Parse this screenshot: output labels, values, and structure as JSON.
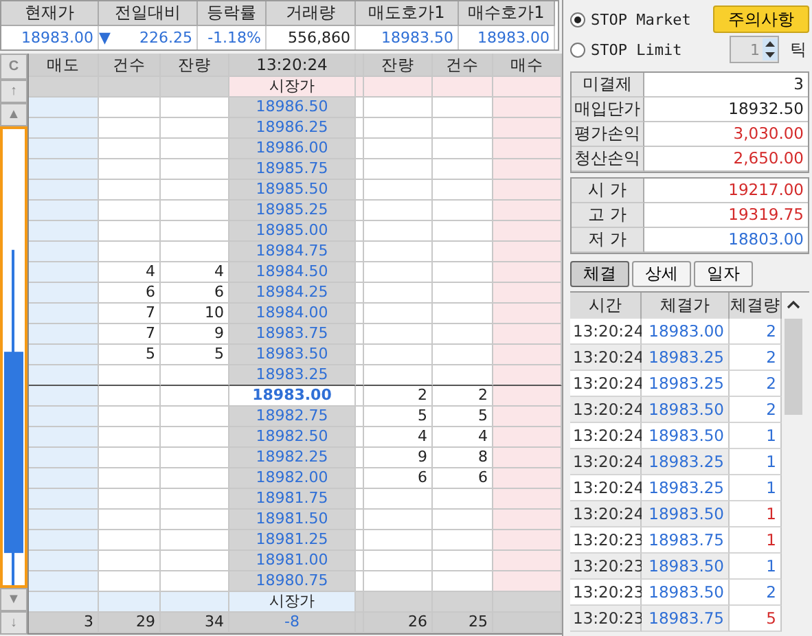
{
  "summary": {
    "columns": [
      "현재가",
      "전일대비",
      "등락률",
      "거래량",
      "매도호가1",
      "매수호가1"
    ],
    "values": [
      {
        "text": "18983.00",
        "color": "#2f6fd6"
      },
      {
        "arrow": "▼",
        "text": "226.25",
        "color": "#2f6fd6"
      },
      {
        "text": "-1.18%",
        "color": "#2f6fd6"
      },
      {
        "text": "556,860",
        "color": "#222222"
      },
      {
        "text": "18983.50",
        "color": "#2f6fd6"
      },
      {
        "text": "18983.00",
        "color": "#2f6fd6"
      }
    ]
  },
  "strip": {
    "top": [
      "C",
      "↑",
      "▲"
    ],
    "bottom": [
      "▼",
      "↓"
    ]
  },
  "orderbook": {
    "columns": [
      "매도",
      "건수",
      "잔량",
      "13:20:24",
      "잔량",
      "건수",
      "매수"
    ],
    "market_top": "시장가",
    "market_bottom": "시장가",
    "rows": [
      {
        "price": "18986.50",
        "current": false
      },
      {
        "price": "18986.25",
        "current": false
      },
      {
        "price": "18986.00",
        "current": false
      },
      {
        "price": "18985.75",
        "current": false
      },
      {
        "price": "18985.50",
        "current": false
      },
      {
        "price": "18985.25",
        "current": false
      },
      {
        "price": "18985.00",
        "current": false
      },
      {
        "price": "18984.75",
        "current": false
      },
      {
        "price": "18984.50",
        "sell_count": "4",
        "sell_qty": "4",
        "current": false
      },
      {
        "price": "18984.25",
        "sell_count": "6",
        "sell_qty": "6",
        "current": false
      },
      {
        "price": "18984.00",
        "sell_count": "7",
        "sell_qty": "10",
        "current": false
      },
      {
        "price": "18983.75",
        "sell_count": "7",
        "sell_qty": "9",
        "current": false
      },
      {
        "price": "18983.50",
        "sell_count": "5",
        "sell_qty": "5",
        "current": false
      },
      {
        "price": "18983.25",
        "current": false
      },
      {
        "price": "18983.00",
        "buy_qty": "2",
        "buy_count": "2",
        "current": true
      },
      {
        "price": "18982.75",
        "buy_qty": "5",
        "buy_count": "5",
        "current": false
      },
      {
        "price": "18982.50",
        "buy_qty": "4",
        "buy_count": "4",
        "current": false
      },
      {
        "price": "18982.25",
        "buy_qty": "9",
        "buy_count": "8",
        "current": false
      },
      {
        "price": "18982.00",
        "buy_qty": "6",
        "buy_count": "6",
        "current": false
      },
      {
        "price": "18981.75",
        "current": false
      },
      {
        "price": "18981.50",
        "current": false
      },
      {
        "price": "18981.25",
        "current": false
      },
      {
        "price": "18981.00",
        "current": false
      },
      {
        "price": "18980.75",
        "current": false
      }
    ],
    "totals": [
      "3",
      "29",
      "34",
      "-8",
      "26",
      "25"
    ]
  },
  "stop_orders": [
    {
      "label": "STOP Market",
      "selected": true
    },
    {
      "label": "STOP Limit",
      "selected": false
    }
  ],
  "notice_button": "주의사항",
  "tick_spinner": {
    "value": "1",
    "unit": "틱"
  },
  "position": [
    {
      "label": "미결제",
      "value": "3",
      "color": "#222222"
    },
    {
      "label": "매입단가",
      "value": "18932.50",
      "color": "#222222"
    },
    {
      "label": "평가손익",
      "value": "3,030.00",
      "color": "#d42a2a"
    },
    {
      "label": "청산손익",
      "value": "2,650.00",
      "color": "#d42a2a"
    }
  ],
  "prices": [
    {
      "label": "시 가",
      "value": "19217.00",
      "color": "#d42a2a"
    },
    {
      "label": "고 가",
      "value": "19319.75",
      "color": "#d42a2a"
    },
    {
      "label": "저 가",
      "value": "18803.00",
      "color": "#2f6fd6"
    }
  ],
  "tabs": [
    {
      "label": "체결",
      "selected": true
    },
    {
      "label": "상세",
      "selected": false
    },
    {
      "label": "일자",
      "selected": false
    }
  ],
  "trades": {
    "columns": [
      "시간",
      "체결가",
      "체결량"
    ],
    "rows": [
      {
        "time": "13:20:24",
        "price": "18983.00",
        "qty": "2",
        "color": "#2f6fd6"
      },
      {
        "time": "13:20:24",
        "price": "18983.25",
        "qty": "2",
        "color": "#2f6fd6"
      },
      {
        "time": "13:20:24",
        "price": "18983.25",
        "qty": "2",
        "color": "#2f6fd6"
      },
      {
        "time": "13:20:24",
        "price": "18983.50",
        "qty": "2",
        "color": "#2f6fd6"
      },
      {
        "time": "13:20:24",
        "price": "18983.50",
        "qty": "1",
        "color": "#2f6fd6"
      },
      {
        "time": "13:20:24",
        "price": "18983.25",
        "qty": "1",
        "color": "#2f6fd6"
      },
      {
        "time": "13:20:24",
        "price": "18983.25",
        "qty": "1",
        "color": "#2f6fd6"
      },
      {
        "time": "13:20:24",
        "price": "18983.50",
        "qty": "1",
        "color": "#d42a2a"
      },
      {
        "time": "13:20:23",
        "price": "18983.75",
        "qty": "1",
        "color": "#d42a2a"
      },
      {
        "time": "13:20:23",
        "price": "18983.50",
        "qty": "1",
        "color": "#2f6fd6"
      },
      {
        "time": "13:20:23",
        "price": "18983.50",
        "qty": "2",
        "color": "#2f6fd6"
      },
      {
        "time": "13:20:23",
        "price": "18983.75",
        "qty": "5",
        "color": "#d42a2a"
      }
    ]
  }
}
